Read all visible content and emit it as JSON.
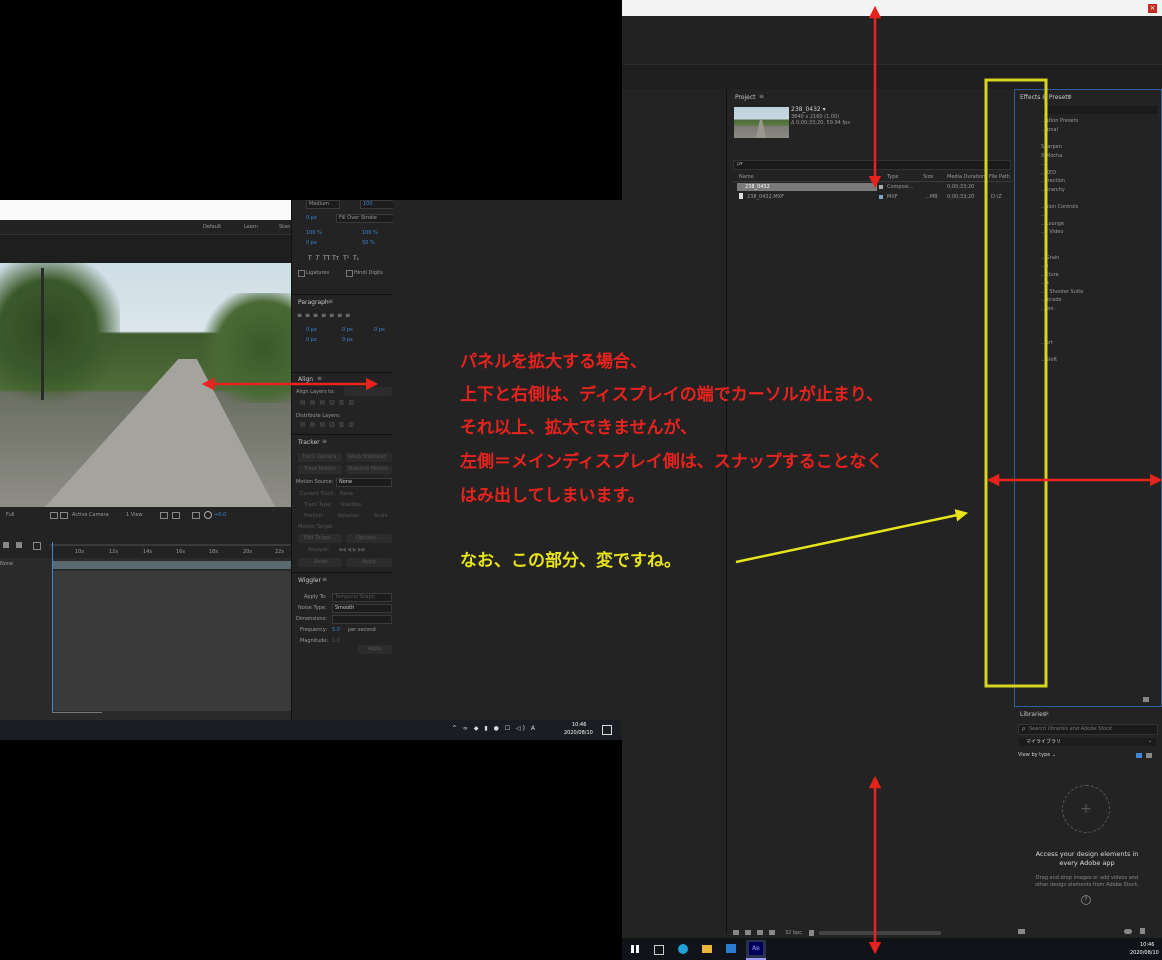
{
  "right_window": {
    "project": {
      "title": "Project",
      "comp_name": "238_0432 ▾",
      "comp_info1": "3840 x 2160 (1.00)",
      "comp_info2": "Δ 0;00;33;20, 59.94 fps",
      "search_placeholder": "ρ▾",
      "columns": [
        "Name",
        "Type",
        "Size",
        "Media Duration",
        "File Path"
      ],
      "rows": [
        {
          "name": "238_0432",
          "type": "Composi...",
          "size": "",
          "duration": "0;00;33;20",
          "path": ""
        },
        {
          "name": "238_0432.MXF",
          "type": "MXF",
          "size": "...MB",
          "duration": "0;00;33;20",
          "path": "D:\\Z"
        }
      ],
      "bpc": "32 bpc"
    },
    "effects": {
      "title": "Effects & Presets",
      "items": [
        "...ation Presets",
        "...ional",
        "",
        "Sharpen",
        "X Mocha",
        "...",
        "...KED",
        "...rrection",
        "...erarchy",
        "",
        "...sion Controls",
        "...r",
        "...Lounge",
        "...r Video",
        "",
        "",
        "...Grain",
        "...s",
        "...cture",
        "...a",
        "...r Shooter Suite",
        "...lorado",
        "...bin",
        "",
        "",
        "",
        "...ort",
        "",
        "...Shift"
      ]
    },
    "libraries": {
      "title": "Libraries",
      "search_placeholder": "Search libraries and Adobe Stock",
      "dropdown": "マイライブラリ",
      "view_by": "View by type ⌄",
      "access_title": "Access your design elements in every Adobe app",
      "access_body": "Drag and drop images or add videos and other design elements from Adobe Stock."
    },
    "taskbar": {
      "time": "10:46",
      "date": "2020/08/10"
    }
  },
  "left_window": {
    "workspace_tabs": [
      "Default",
      "Learn",
      "Stan"
    ],
    "character": {
      "font_style": "Medium",
      "size": "100",
      "stroke": "0 px",
      "stroke_type": "Fill Over Stroke",
      "vscale": "100 %",
      "hscale": "100 %",
      "baseline": "0 px",
      "tsume": "50 %",
      "ligatures": "Ligatures",
      "hindi": "Hindi Digits"
    },
    "paragraph": {
      "title": "Paragraph",
      "values": [
        "0 px",
        "0 px",
        "0 px",
        "0 px",
        "0 px"
      ]
    },
    "align": {
      "title": "Align",
      "align_to": "Align Layers to:",
      "distribute": "Distribute Layers:"
    },
    "tracker": {
      "title": "Tracker",
      "buttons": [
        "Track Camera",
        "Warp Stabilizer",
        "Track Motion",
        "Stabilize Motion"
      ],
      "motion_source_label": "Motion Source:",
      "motion_source": "None",
      "current_track_label": "Current Track:",
      "current_track": "None",
      "track_type_label": "Track Type:",
      "track_type": "Stabilize",
      "checks": [
        "Position",
        "Rotation",
        "Scale"
      ],
      "motion_target": "Motion Target:",
      "edit_target": "Edit Target...",
      "options": "Options...",
      "analyze": "Analyze:",
      "reset": "Reset",
      "apply": "Apply"
    },
    "wiggler": {
      "title": "Wiggler",
      "apply_to_label": "Apply To:",
      "apply_to": "Temporal Graph",
      "noise_label": "Noise Type:",
      "noise": "Smooth",
      "dimensions_label": "Dimensions:",
      "frequency_label": "Frequency:",
      "frequency": "5.0",
      "per_second": "per second",
      "magnitude_label": "Magnitude:",
      "magnitude": "1.0",
      "apply": "Apply"
    },
    "viewer": {
      "resolution": "Full",
      "camera": "Active Camera",
      "views": "1 View",
      "exposure": "+0.0"
    },
    "timeline": {
      "ticks": [
        "10s",
        "12s",
        "14s",
        "16s",
        "18s",
        "20s",
        "22s"
      ],
      "mode": "None"
    },
    "taskbar": {
      "time": "10:46",
      "date": "2020/08/10"
    }
  },
  "annotations": {
    "red_lines": [
      "パネルを拡大する場合、",
      "上下と右側は、ディスプレイの端でカーソルが止まり、",
      "それ以上、拡大できませんが、",
      "左側＝メインディスプレイ側は、スナップすることなく",
      "はみ出してしまいます。"
    ],
    "yellow_line": "なお、この部分、変ですね。"
  },
  "colors": {
    "annotation_red": "#e8231d",
    "annotation_yellow": "#e8e41c",
    "panel_bg": "#232323"
  }
}
